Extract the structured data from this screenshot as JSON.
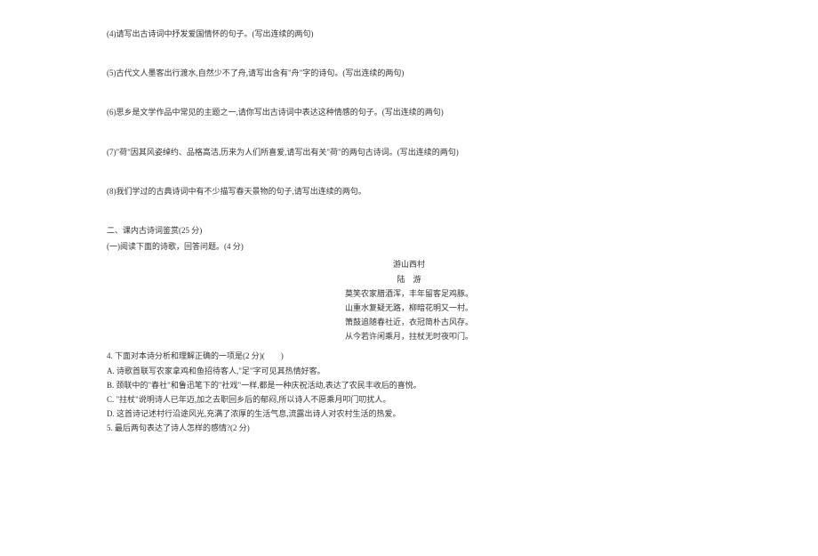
{
  "questions": {
    "q4": "(4)请写出古诗词中抒发爱国情怀的句子。(写出连续的两句)",
    "q5": "(5)古代文人墨客出行渡水,自然少不了舟,请写出含有\"舟\"字的诗句。(写出连续的两句)",
    "q6": "(6)思乡是文学作品中常见的主题之一,请你写出古诗词中表达这种情感的句子。(写出连续的两句)",
    "q7": "(7)\"荷\"因其风姿绰约、品格高洁,历来为人们所喜爱,请写出有关\"荷\"的两句古诗词。(写出连续的两句)",
    "q8": "(8)我们学过的古典诗词中有不少描写春天景物的句子,请写出连续的两句。"
  },
  "section2": {
    "title": "二、课内古诗词鉴赏(25 分)",
    "reading1": {
      "intro": "(一)阅读下面的诗歌，回答问题。(4 分)",
      "poem": {
        "title": "游山西村",
        "author": "陆　游",
        "lines": [
          "莫笑农家腊酒浑，丰年留客足鸡豚。",
          "山重水复疑无路，柳暗花明又一村。",
          "箫鼓追随春社近，衣冠简朴古风存。",
          "从今若许闲乘月，拄杖无时夜叩门。"
        ]
      },
      "q4_text": "4. 下面对本诗分析和理解正确的一项是(2 分)(　　)",
      "options": {
        "A": "A. 诗歌首联写农家拿鸡和鱼招待客人,\"足\"字可见其热情好客。",
        "B": "B. 颈联中的\"春社\"和鲁迅笔下的\"社戏\"一样,都是一种庆祝活动,表达了农民丰收后的喜悦。",
        "C": "C. \"拄杖\"说明诗人已年迈,加之去职回乡后的郁闷,所以诗人不愿乘月叩门叨扰人。",
        "D": "D. 这首诗记述村行沿途风光,充满了浓厚的生活气息,流露出诗人对农村生活的热爱。"
      },
      "q5_text": "5. 最后两句表达了诗人怎样的感情?(2 分)"
    }
  }
}
